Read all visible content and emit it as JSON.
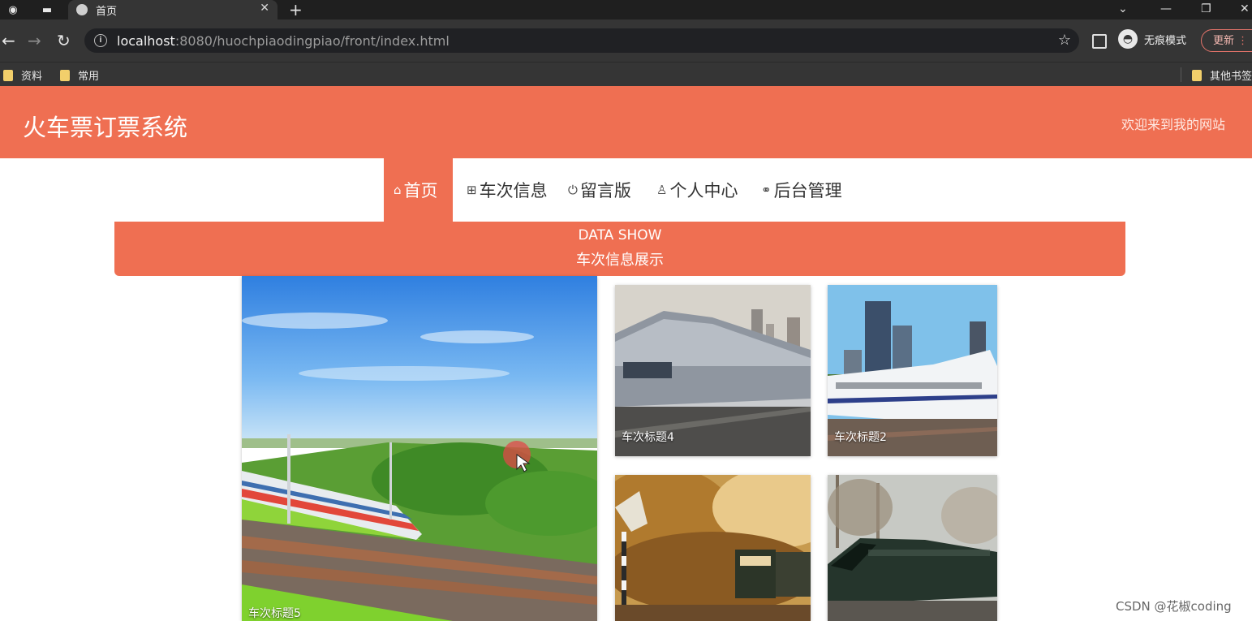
{
  "browser": {
    "tab_title": "首页",
    "url_host": "localhost",
    "url_path": ":8080/huochpiaodingpiao/front/index.html",
    "incognito_label": "无痕模式",
    "update_label": "更新",
    "bookmarks": [
      "资料",
      "常用"
    ],
    "other_bookmarks": "其他书签"
  },
  "site": {
    "title": "火车票订票系统",
    "welcome": "欢迎来到我的网站"
  },
  "nav": {
    "items": [
      {
        "label": "首页",
        "icon": "home-icon",
        "active": true
      },
      {
        "label": "车次信息",
        "icon": "train-icon",
        "active": false
      },
      {
        "label": "留言版",
        "icon": "power-icon",
        "active": false
      },
      {
        "label": "个人中心",
        "icon": "user-icon",
        "active": false
      },
      {
        "label": "后台管理",
        "icon": "link-icon",
        "active": false
      }
    ]
  },
  "data_show": {
    "title_en": "DATA SHOW",
    "title_cn": "车次信息展示"
  },
  "cards": [
    {
      "caption": "车次标题5"
    },
    {
      "caption": "车次标题4"
    },
    {
      "caption": "车次标题2"
    },
    {
      "caption": ""
    },
    {
      "caption": ""
    }
  ],
  "watermark": "CSDN @花椒coding",
  "colors": {
    "accent": "#ef6f52",
    "chrome_dark": "#353535"
  }
}
